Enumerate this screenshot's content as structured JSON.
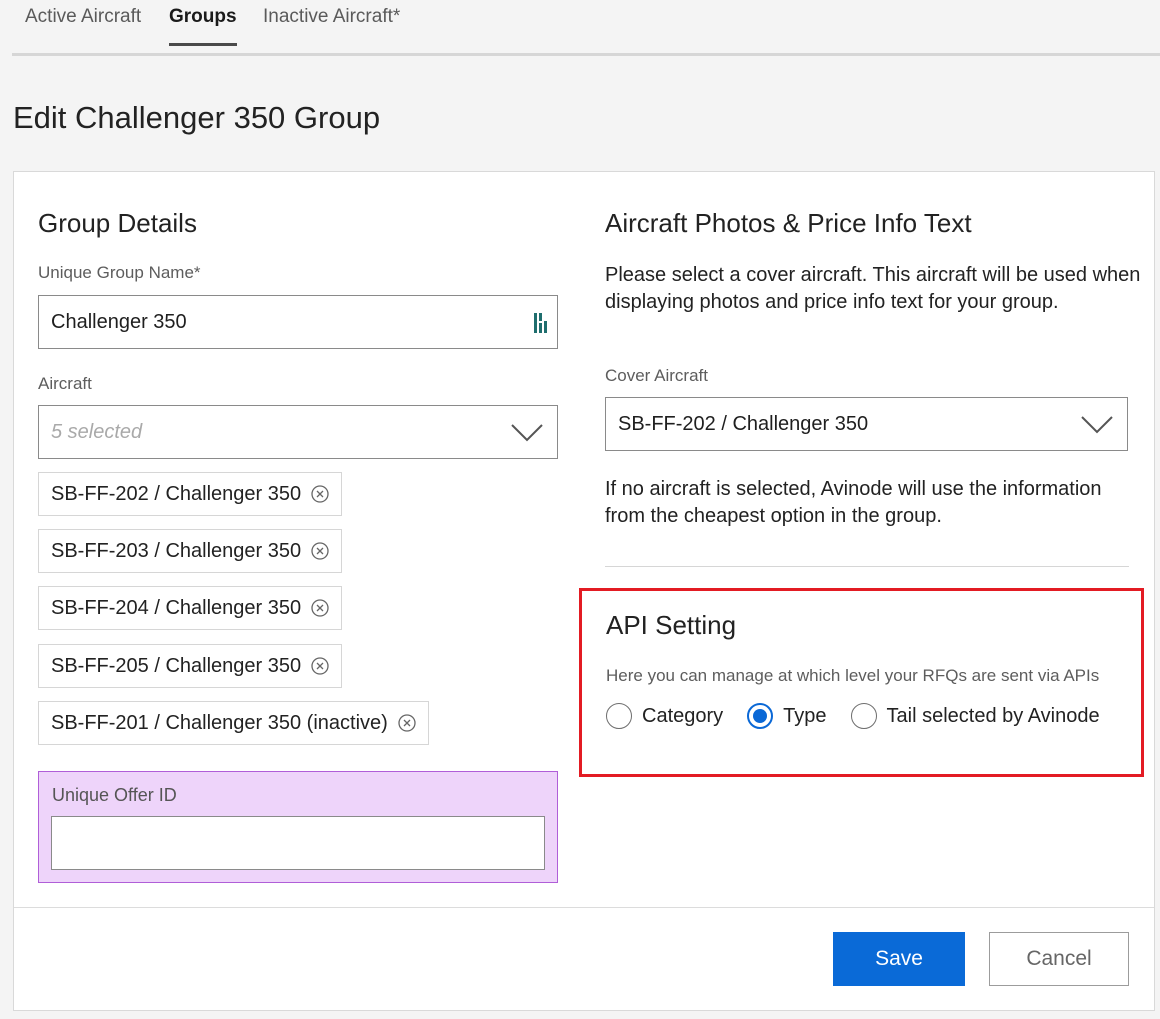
{
  "tabs": [
    {
      "label": "Active Aircraft",
      "active": false
    },
    {
      "label": "Groups",
      "active": true
    },
    {
      "label": "Inactive Aircraft*",
      "active": false
    }
  ],
  "page_title": "Edit Challenger 350 Group",
  "group_details": {
    "title": "Group Details",
    "name_label": "Unique Group Name*",
    "name_value": "Challenger 350",
    "aircraft_label": "Aircraft",
    "aircraft_placeholder": "5 selected",
    "selected_aircraft": [
      "SB-FF-202 / Challenger 350",
      "SB-FF-203 / Challenger 350",
      "SB-FF-204 / Challenger 350",
      "SB-FF-205 / Challenger 350",
      "SB-FF-201 / Challenger 350 (inactive)"
    ],
    "offer_id_label": "Unique Offer ID",
    "offer_id_value": ""
  },
  "photos": {
    "title": "Aircraft Photos & Price Info Text",
    "description": "Please select a cover aircraft. This aircraft will be used when displaying photos and price info text for your group.",
    "cover_label": "Cover Aircraft",
    "cover_value": "SB-FF-202 / Challenger 350",
    "note": "If no aircraft is selected, Avinode will use the information from the cheapest option in the group."
  },
  "api_setting": {
    "title": "API Setting",
    "description": "Here you can manage at which level your RFQs are sent via APIs",
    "options": [
      {
        "label": "Category",
        "selected": false
      },
      {
        "label": "Type",
        "selected": true
      },
      {
        "label": "Tail selected by Avinode",
        "selected": false
      }
    ],
    "highlight_color": "#e31b23"
  },
  "actions": {
    "save_label": "Save",
    "cancel_label": "Cancel"
  },
  "colors": {
    "accent": "#0a6ad7",
    "offer_highlight": "#eed4fa"
  }
}
